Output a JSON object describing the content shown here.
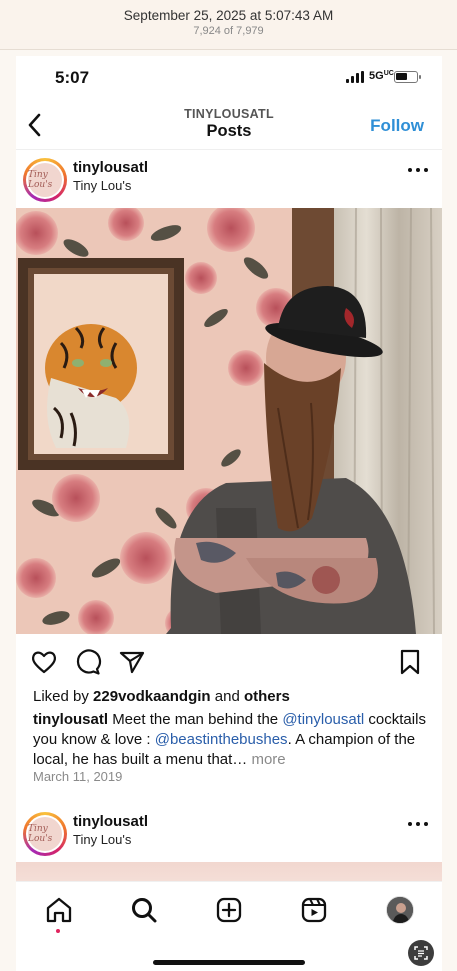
{
  "photos_app": {
    "date": "September 25, 2025 at 5:07:43 AM",
    "count": "7,924 of 7,979"
  },
  "status_bar": {
    "time": "5:07",
    "network": "5G",
    "network_suffix": "UC"
  },
  "nav": {
    "username": "TINYLOUSATL",
    "title": "Posts",
    "follow_label": "Follow"
  },
  "post": {
    "avatar_text": "Tiny Lou's",
    "username": "tinylousatl",
    "location": "Tiny Lou's",
    "likes_prefix": "Liked by",
    "likes_user": "229vodkaandgin",
    "likes_mid": "and",
    "likes_suffix": "others",
    "caption_user": "tinylousatl",
    "caption_text_1": "Meet the man behind the",
    "caption_mention_1": "@tinylousatl",
    "caption_text_2": "cocktails you know & love :",
    "caption_mention_2": "@beastinthebushes",
    "caption_text_3": ". A champion of the local, he has built a menu that…",
    "caption_more": "more",
    "date": "March 11, 2019"
  },
  "next_post": {
    "avatar_text": "Tiny Lou's",
    "username": "tinylousatl",
    "location": "Tiny Lou's"
  },
  "icons": {
    "back": "chevron-left-icon",
    "like": "heart-icon",
    "comment": "comment-icon",
    "share": "send-icon",
    "save": "bookmark-icon",
    "home": "home-icon",
    "search": "search-icon",
    "create": "plus-square-icon",
    "reels": "reels-icon",
    "profile": "profile-avatar"
  },
  "colors": {
    "accent": "#2f8fd6",
    "mention": "#2a5eaa",
    "notification_dot": "#e0245e"
  }
}
